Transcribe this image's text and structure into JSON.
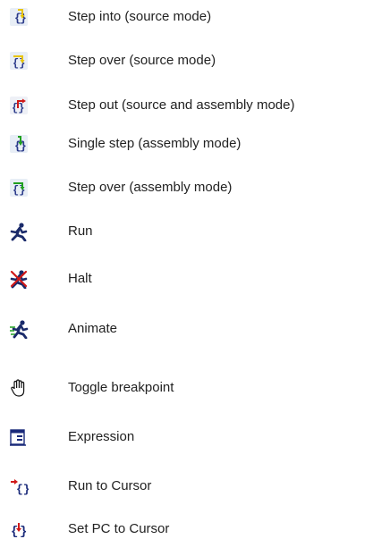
{
  "legend": {
    "items": [
      {
        "icon": "step-into-icon",
        "label": "Step into (source mode)"
      },
      {
        "icon": "step-over-source-icon",
        "label": "Step over (source mode)"
      },
      {
        "icon": "step-out-icon",
        "label": "Step out (source and assembly mode)"
      },
      {
        "icon": "single-step-icon",
        "label": "Single step (assembly mode)"
      },
      {
        "icon": "step-over-assembly-icon",
        "label": "Step over (assembly mode)"
      },
      {
        "icon": "run-icon",
        "label": "Run"
      },
      {
        "icon": "halt-icon",
        "label": "Halt"
      },
      {
        "icon": "animate-icon",
        "label": "Animate"
      },
      {
        "icon": "hand-icon",
        "label": "Toggle breakpoint"
      },
      {
        "icon": "expression-icon",
        "label": "Expression"
      },
      {
        "icon": "run-to-cursor-icon",
        "label": "Run to Cursor"
      },
      {
        "icon": "set-pc-icon",
        "label": "Set PC to Cursor"
      }
    ]
  }
}
